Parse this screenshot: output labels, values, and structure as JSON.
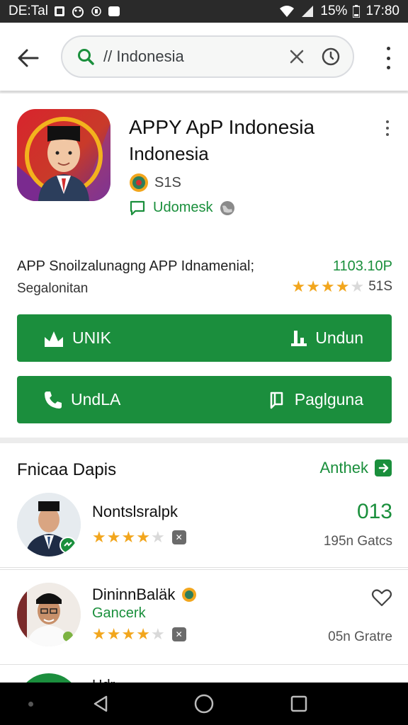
{
  "status_bar": {
    "carrier": "DE:Tal",
    "battery": "15%",
    "time": "17:80"
  },
  "search": {
    "query": "// Indonesia"
  },
  "app": {
    "title": "APPY ApP Indonesia",
    "subtitle": "Indonesia",
    "meta_text": "S1S",
    "developer": "Udomesk",
    "description_line1": "APP Snoilzalunagng APP Idnamenial;",
    "description_line2": "Segalonitan",
    "size_value": "1103.10P",
    "rating_count": "51S",
    "rating": 3.5,
    "buttons": [
      {
        "label_left": "UNIK",
        "label_right": "Undun"
      },
      {
        "label_left": "UndLA",
        "label_right": "Paglguna"
      }
    ]
  },
  "section": {
    "title": "Fnicaa Dapis",
    "more_label": "Anthek",
    "items": [
      {
        "name": "Nontslsralpk",
        "subtitle": "",
        "value": "013",
        "meta": "195n Gatcs",
        "rating": 3.5
      },
      {
        "name": "DininnBaläk",
        "subtitle": "Gancerk",
        "value": "",
        "meta": "05n Gratre",
        "rating": 3.5
      },
      {
        "name": "Hdr",
        "subtitle": "",
        "value": "",
        "meta": "",
        "rating": 0
      }
    ]
  },
  "colors": {
    "accent_green": "#1b8e3d",
    "star_gold": "#f2a61d",
    "status_bar": "#2a2a2a"
  }
}
